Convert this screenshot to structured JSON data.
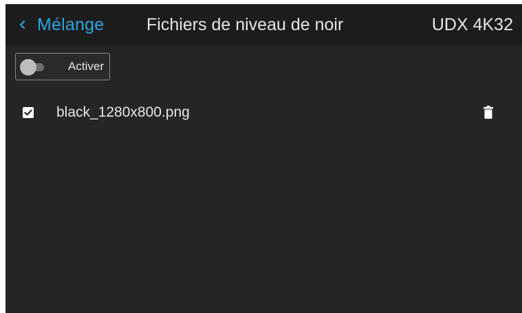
{
  "header": {
    "back_label": "Mélange",
    "title": "Fichiers de niveau de noir",
    "device": "UDX 4K32"
  },
  "toggle": {
    "label": "Activer",
    "state": "off"
  },
  "files": [
    {
      "name": "black_1280x800.png",
      "checked": true
    }
  ],
  "colors": {
    "accent": "#2aa5e0",
    "background": "#252525",
    "header_background": "#1c1c1c",
    "text": "#e6e6e6"
  },
  "icons": {
    "back": "chevron-left-icon",
    "checkbox": "checkbox-checked-icon",
    "delete": "trash-icon",
    "toggle": "toggle-switch-icon"
  }
}
